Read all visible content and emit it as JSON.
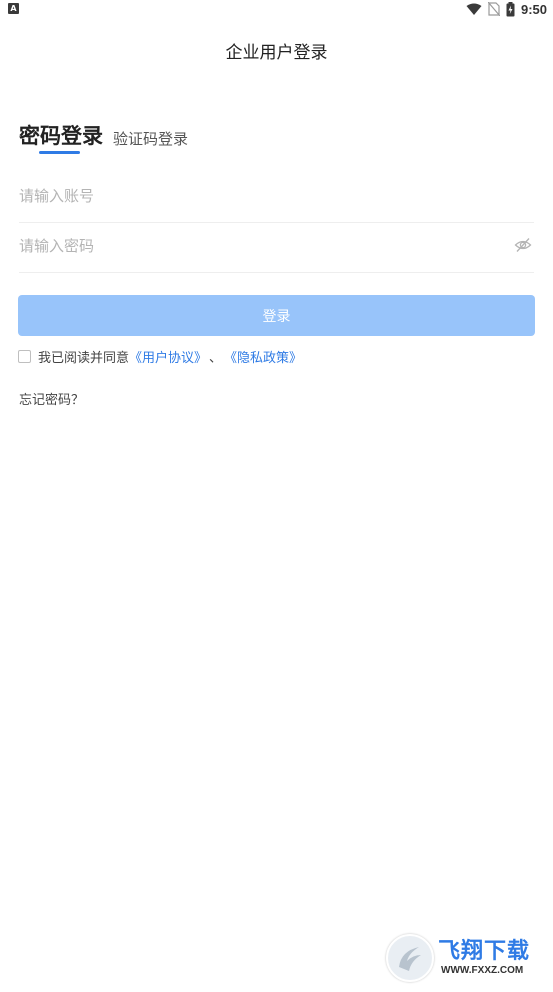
{
  "status_bar": {
    "left_badge": "A",
    "time": "9:50"
  },
  "header": {
    "title": "企业用户登录"
  },
  "tabs": {
    "password_login": "密码登录",
    "code_login": "验证码登录"
  },
  "form": {
    "account_placeholder": "请输入账号",
    "account_value": "",
    "password_placeholder": "请输入密码",
    "password_value": "",
    "login_button": "登录"
  },
  "agreement": {
    "prefix": "我已阅读并同意",
    "user_agreement": "《用户协议》",
    "separator": "、",
    "privacy_policy": "《隐私政策》",
    "checked": false
  },
  "forgot_password": "忘记密码？",
  "watermark": {
    "title": "飞翔下载",
    "url": "WWW.FXXZ.COM"
  },
  "colors": {
    "accent": "#2f7be5",
    "button_disabled": "#98c4fa",
    "placeholder": "#b4b4b4"
  },
  "icons": {
    "wifi": "wifi-icon",
    "sim": "no-sim-icon",
    "battery": "battery-charging-icon",
    "password_visibility": "eye-off-icon"
  }
}
